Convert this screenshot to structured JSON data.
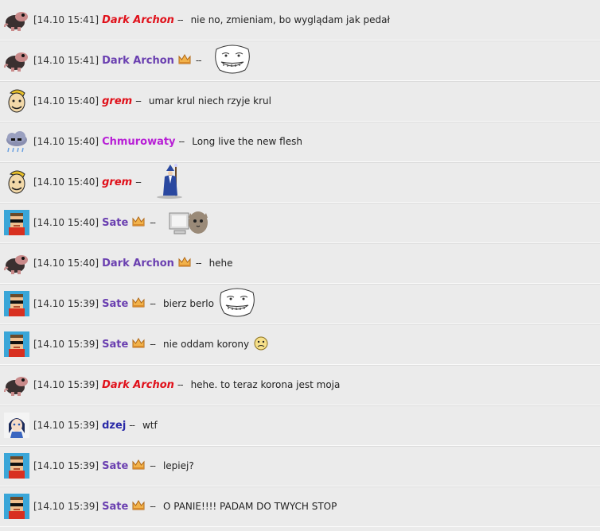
{
  "messages": [
    {
      "avatar": "mole-avatar",
      "time": "[14.10 15:41]",
      "nick": "Dark Archon",
      "nick_style": "red",
      "crown": false,
      "sep": "--",
      "text": "nie no, zmieniam, bo wyglądam jak pedał",
      "emote": ""
    },
    {
      "avatar": "mole-avatar",
      "time": "[14.10 15:41]",
      "nick": "Dark Archon",
      "nick_style": "purple",
      "crown": true,
      "sep": "--",
      "text": "",
      "emote": "troll-face-emote"
    },
    {
      "avatar": "vault-boy-avatar",
      "time": "[14.10 15:40]",
      "nick": "grem",
      "nick_style": "red",
      "crown": false,
      "sep": "--",
      "text": "umar krul niech rzyje krul",
      "emote": ""
    },
    {
      "avatar": "cloud-avatar",
      "time": "[14.10 15:40]",
      "nick": "Chmurowaty",
      "nick_style": "magenta",
      "crown": false,
      "sep": "--",
      "text": "Long live the new flesh",
      "emote": ""
    },
    {
      "avatar": "vault-boy-avatar",
      "time": "[14.10 15:40]",
      "nick": "grem",
      "nick_style": "red",
      "crown": false,
      "sep": "--",
      "text": "",
      "emote": "wizard-emote"
    },
    {
      "avatar": "pixel-sunglasses-avatar",
      "time": "[14.10 15:40]",
      "nick": "Sate",
      "nick_style": "purple",
      "crown": true,
      "sep": "--",
      "text": "",
      "emote": "cat-computer-emote"
    },
    {
      "avatar": "mole-avatar",
      "time": "[14.10 15:40]",
      "nick": "Dark Archon",
      "nick_style": "purple",
      "crown": true,
      "sep": "--",
      "text": "hehe",
      "emote": ""
    },
    {
      "avatar": "pixel-sunglasses-avatar",
      "time": "[14.10 15:39]",
      "nick": "Sate",
      "nick_style": "purple",
      "crown": true,
      "sep": "--",
      "text": "bierz berlo",
      "emote": "troll-face-emote"
    },
    {
      "avatar": "pixel-sunglasses-avatar",
      "time": "[14.10 15:39]",
      "nick": "Sate",
      "nick_style": "purple",
      "crown": true,
      "sep": "--",
      "text": "nie oddam korony",
      "emote": "worried-smiley-emote"
    },
    {
      "avatar": "mole-avatar",
      "time": "[14.10 15:39]",
      "nick": "Dark Archon",
      "nick_style": "red",
      "crown": false,
      "sep": "--",
      "text": "hehe. to teraz korona jest moja",
      "emote": ""
    },
    {
      "avatar": "anime-girl-avatar",
      "time": "[14.10 15:39]",
      "nick": "dzej",
      "nick_style": "navy",
      "crown": false,
      "sep": "--",
      "text": "wtf",
      "emote": ""
    },
    {
      "avatar": "pixel-sunglasses-avatar",
      "time": "[14.10 15:39]",
      "nick": "Sate",
      "nick_style": "purple",
      "crown": true,
      "sep": "--",
      "text": "lepiej?",
      "emote": ""
    },
    {
      "avatar": "pixel-sunglasses-avatar",
      "time": "[14.10 15:39]",
      "nick": "Sate",
      "nick_style": "purple",
      "crown": true,
      "sep": "--",
      "text": "O PANIE!!!! PADAM DO TWYCH STOP",
      "emote": ""
    }
  ],
  "colors": {
    "background": "#ebebeb",
    "nick_red": "#e0101a",
    "nick_purple": "#6a3fb0",
    "nick_magenta": "#b81fd6",
    "nick_navy": "#2a2aa8",
    "crown": "#e8a23a"
  }
}
